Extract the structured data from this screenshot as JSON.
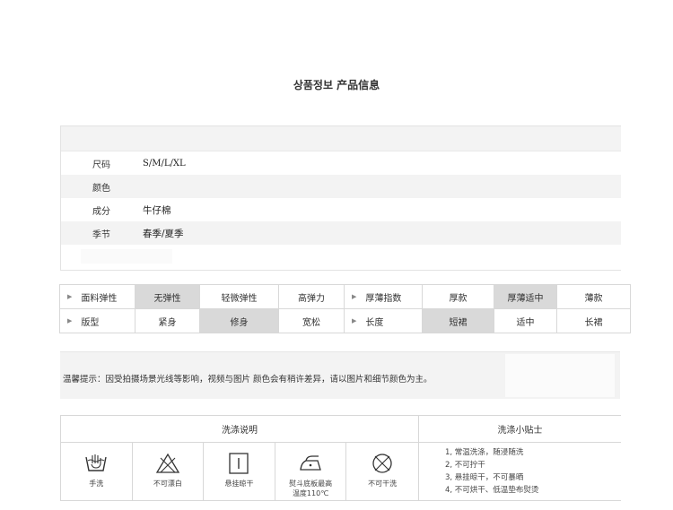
{
  "title": "상품정보 产品信息",
  "info": {
    "rows": [
      {
        "key": "尺码",
        "value": "S/M/L/XL"
      },
      {
        "key": "颜色",
        "value": ""
      },
      {
        "key": "成分",
        "value": "牛仔棉"
      },
      {
        "key": "季节",
        "value": "春季/夏季"
      }
    ]
  },
  "attrs": {
    "row1": {
      "label1": "面料弹性",
      "opts1": [
        "无弹性",
        "轻微弹性",
        "高弹力"
      ],
      "selected1": "无弹性",
      "label2": "厚薄指数",
      "opts2": [
        "厚款",
        "厚薄适中",
        "薄款"
      ],
      "selected2": "厚薄适中"
    },
    "row2": {
      "label1": "版型",
      "opts1": [
        "紧身",
        "修身",
        "宽松"
      ],
      "selected1": "修身",
      "label2": "长度",
      "opts2": [
        "短裙",
        "适中",
        "长裙"
      ],
      "selected2": "短裙"
    }
  },
  "notice": "温馨提示：因受拍摄场景光线等影响，视频与图片 颜色会有稍许差异，请以图片和细节颜色为主。",
  "wash": {
    "left_header": "洗涤说明",
    "right_header": "洗涤小贴士",
    "icons": [
      {
        "icon": "hand-wash-icon",
        "label": "手洗"
      },
      {
        "icon": "no-bleach-icon",
        "label": "不可漂白"
      },
      {
        "icon": "hang-dry-icon",
        "label": "悬挂晾干"
      },
      {
        "icon": "iron-icon",
        "label": "熨斗底板最高",
        "label2": "温度110℃"
      },
      {
        "icon": "no-dry-clean-icon",
        "label": "不可干洗"
      }
    ],
    "tips": [
      "1, 常温洗涤，随浸随洗",
      "2, 不可拧干",
      "3, 悬挂晾干，不可暴晒",
      "4, 不可烘干、低温垫布熨烫"
    ]
  }
}
